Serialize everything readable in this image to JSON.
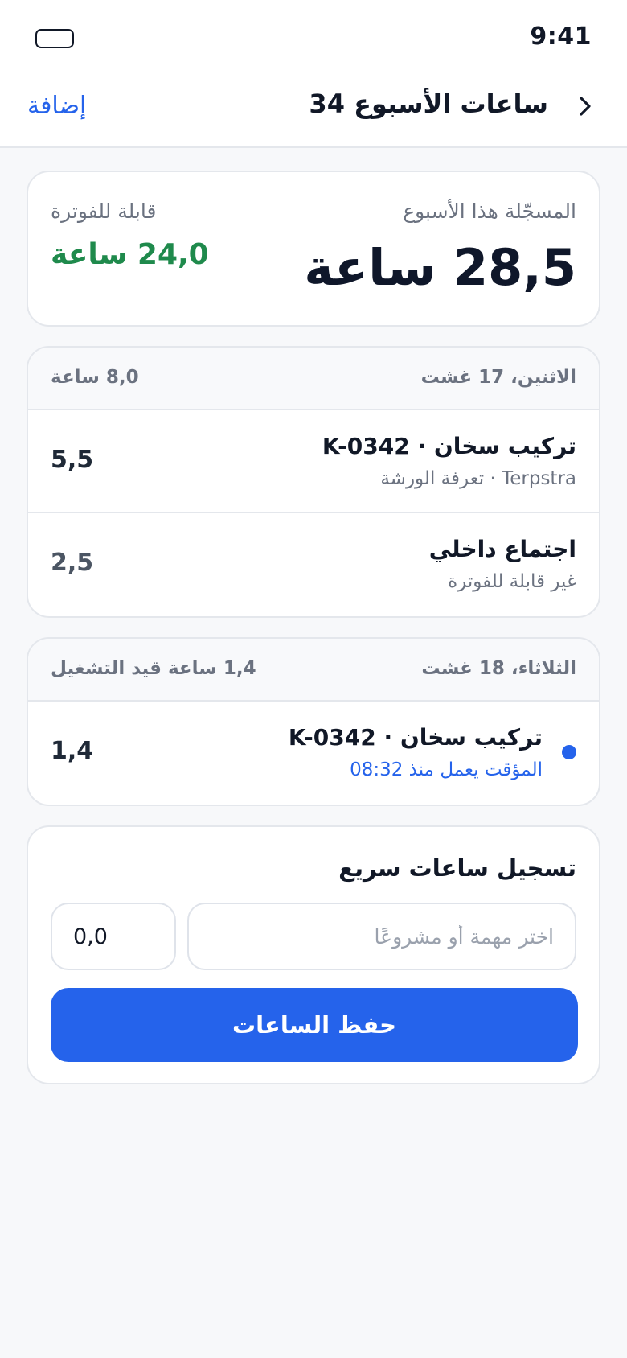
{
  "status_bar": {
    "time": "9:41",
    "battery_icon": "battery-icon"
  },
  "nav": {
    "title": "ساعات الأسبوع 34",
    "add_label": "إضافة",
    "back_icon": "chevron-right-icon"
  },
  "summary": {
    "recorded_label": "المسجّلة هذا الأسبوع",
    "recorded_value": "28,5 ساعة",
    "billable_label": "قابلة للفوترة",
    "billable_value": "24,0 ساعة"
  },
  "days": [
    {
      "date": "الاثنين، 17 غشت",
      "total": "8,0 ساعة",
      "entries": [
        {
          "title": "تركيب سخان · K-0342",
          "subtitle": "Terpstra · تعرفة الورشة",
          "hours": "5,5"
        },
        {
          "title": "اجتماع داخلي",
          "subtitle": "غير قابلة للفوترة",
          "hours": "2,5"
        }
      ]
    },
    {
      "date": "الثلاثاء، 18 غشت",
      "total": "1,4 ساعة قيد التشغيل",
      "entries": [
        {
          "title": "تركيب سخان · K-0342",
          "subtitle": "المؤقت يعمل منذ 08:32",
          "hours": "1,4"
        }
      ]
    }
  ],
  "quick_log": {
    "title": "تسجيل ساعات سريع",
    "task_placeholder": "اختر مهمة أو مشروعًا",
    "hours_value": "0,0",
    "save_label": "حفظ الساعات"
  },
  "colors": {
    "accent": "#2563eb",
    "billable": "#1f8a4c",
    "background": "#f7f8fa"
  }
}
